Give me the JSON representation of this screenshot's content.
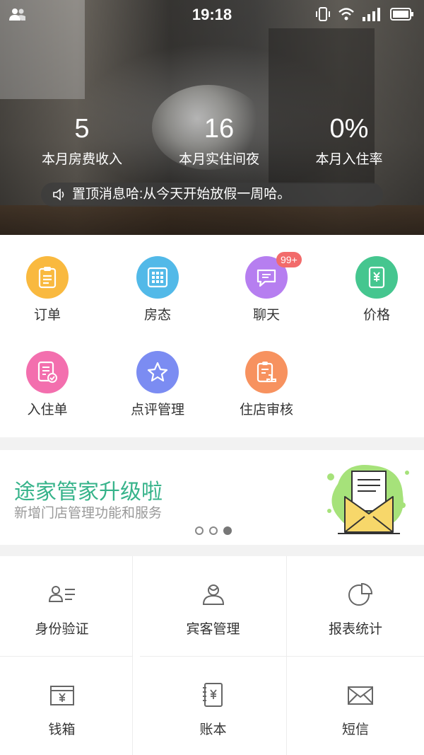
{
  "status_bar": {
    "time": "19:18"
  },
  "stats": [
    {
      "value": "5",
      "label": "本月房费收入"
    },
    {
      "value": "16",
      "label": "本月实住间夜"
    },
    {
      "value": "0%",
      "label": "本月入住率"
    }
  ],
  "notice": {
    "text": "置顶消息哈:从今天开始放假一周哈。"
  },
  "quick_actions": [
    {
      "label": "订单",
      "icon": "order-clipboard-icon",
      "color": "#f9b93f"
    },
    {
      "label": "房态",
      "icon": "room-grid-icon",
      "color": "#52b9e8"
    },
    {
      "label": "聊天",
      "icon": "chat-bubble-icon",
      "color": "#b67ef0",
      "badge": "99+"
    },
    {
      "label": "价格",
      "icon": "price-yuan-icon",
      "color": "#45c68f"
    },
    {
      "label": "入住单",
      "icon": "checkin-form-icon",
      "color": "#f36fae"
    },
    {
      "label": "点评管理",
      "icon": "review-star-icon",
      "color": "#7b8cf2"
    },
    {
      "label": "住店审核",
      "icon": "stay-audit-icon",
      "color": "#f7925f"
    }
  ],
  "banner": {
    "title": "途家管家升级啦",
    "subtitle": "新增门店管理功能和服务",
    "page_count": 3,
    "active_page": 3
  },
  "tools": [
    {
      "label": "身份验证",
      "icon": "id-verify-icon"
    },
    {
      "label": "宾客管理",
      "icon": "guest-icon"
    },
    {
      "label": "报表统计",
      "icon": "pie-chart-icon"
    },
    {
      "label": "钱箱",
      "icon": "cashbox-icon"
    },
    {
      "label": "账本",
      "icon": "ledger-icon"
    },
    {
      "label": "短信",
      "icon": "envelope-icon"
    }
  ]
}
